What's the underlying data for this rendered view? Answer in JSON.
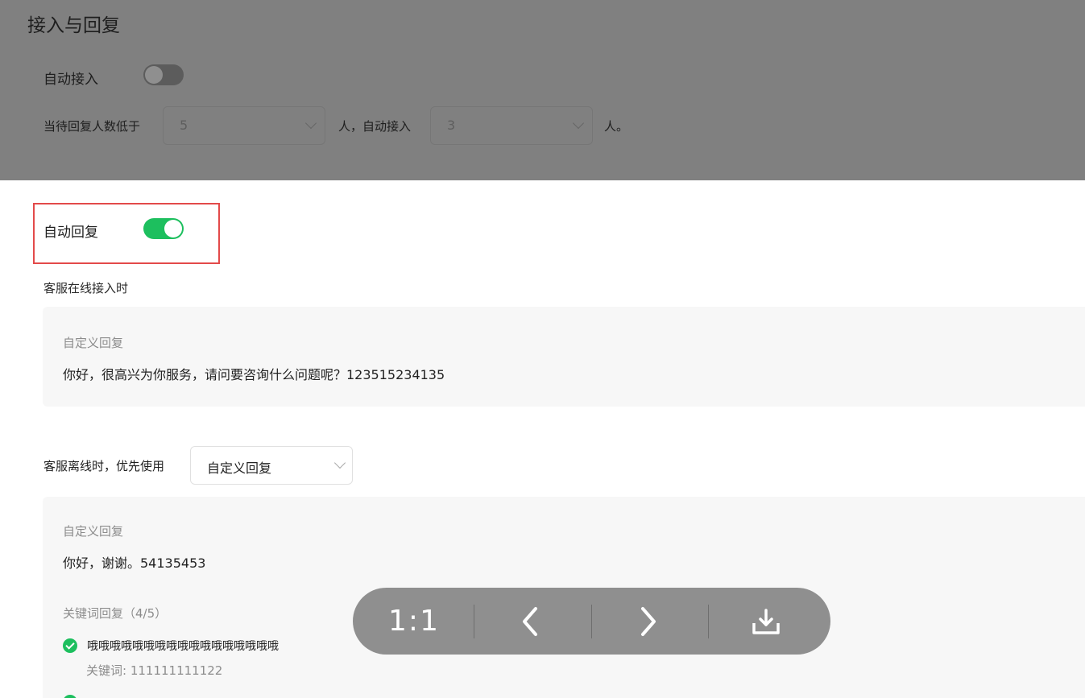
{
  "section": {
    "title": "接入与回复",
    "auto_access_label": "自动接入",
    "auto_access_on": false,
    "threshold_prefix": "当待回复人数低于",
    "threshold_value": "5",
    "threshold_middle": "人，自动接入",
    "access_value": "3",
    "threshold_suffix": "人。"
  },
  "auto_reply": {
    "label": "自动回复",
    "on": true,
    "online_label": "客服在线接入时",
    "online_panel": {
      "title": "自定义回复",
      "text": "你好，很高兴为你服务，请问要咨询什么问题呢？123515234135"
    },
    "offline_label": "客服离线时，优先使用",
    "offline_select": "自定义回复",
    "offline_panel": {
      "title": "自定义回复",
      "text": "你好，谢谢。54135453",
      "keyword_title": "关键词回复（4/5）",
      "keywords": [
        {
          "reply": "哦哦哦哦哦哦哦哦哦哦哦哦哦哦哦哦哦",
          "keyword": "关键词: 111111111122"
        }
      ]
    }
  },
  "viewer": {
    "ratio_label": "1:1",
    "prev_icon": "chevron-left-icon",
    "next_icon": "chevron-right-icon",
    "download_icon": "download-icon"
  },
  "colors": {
    "accent_green": "#1dbf5e",
    "highlight_red": "#e34a4a"
  }
}
